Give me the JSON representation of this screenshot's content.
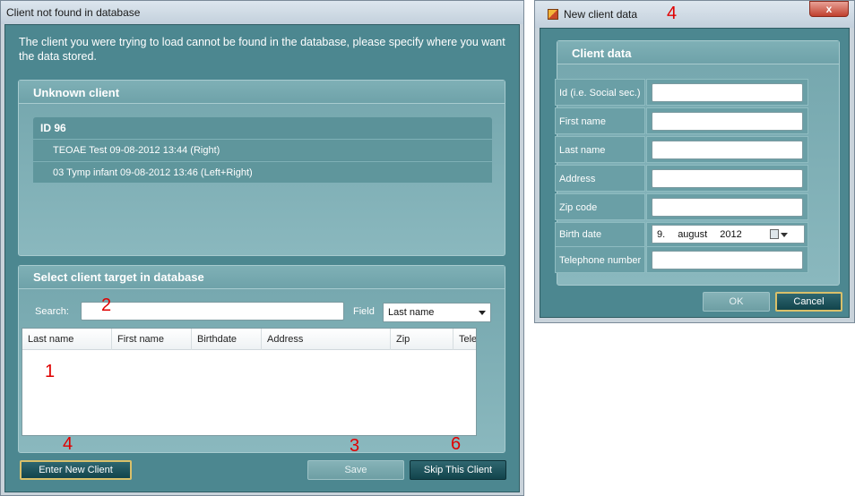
{
  "client_not_found_window": {
    "title": "Client not found in database",
    "intro": "The client you were trying to load cannot be found in the database, please specify where you want the data stored.",
    "unknown_client": {
      "heading": "Unknown client",
      "id_label": "ID 96",
      "sessions": [
        "TEOAE Test 09-08-2012 13:44 (Right)",
        "03 Tymp infant 09-08-2012 13:46 (Left+Right)"
      ]
    },
    "target": {
      "heading": "Select client target in database",
      "search_label": "Search:",
      "search_value": "",
      "field_label": "Field",
      "field_value": "Last name",
      "columns": [
        "Last name",
        "First name",
        "Birthdate",
        "Address",
        "Zip",
        "Tele"
      ]
    },
    "buttons": {
      "enter_new_client": "Enter New Client",
      "save": "Save",
      "skip_client": "Skip This Client"
    }
  },
  "new_client_window": {
    "title": "New client data",
    "close_label": "x",
    "heading": "Client data",
    "fields": [
      {
        "label": "Id (i.e. Social sec.)",
        "value": ""
      },
      {
        "label": "First name",
        "value": ""
      },
      {
        "label": "Last name",
        "value": ""
      },
      {
        "label": "Address",
        "value": ""
      },
      {
        "label": "Zip code",
        "value": ""
      },
      {
        "label": "Birth date",
        "day": "9.",
        "month": "august",
        "year": "2012"
      },
      {
        "label": "Telephone number",
        "value": ""
      }
    ],
    "buttons": {
      "ok": "OK",
      "cancel": "Cancel"
    }
  },
  "annotations": {
    "a1": "1",
    "a2": "2",
    "a3": "3",
    "a4_left": "4",
    "a4_right": "4",
    "a6": "6"
  },
  "colors": {
    "dialog_body": "#4c8790",
    "panel": "#7fb0b6",
    "button_dark": "#12444c",
    "focus_border": "#d9c06a",
    "annotation": "#e00000"
  }
}
